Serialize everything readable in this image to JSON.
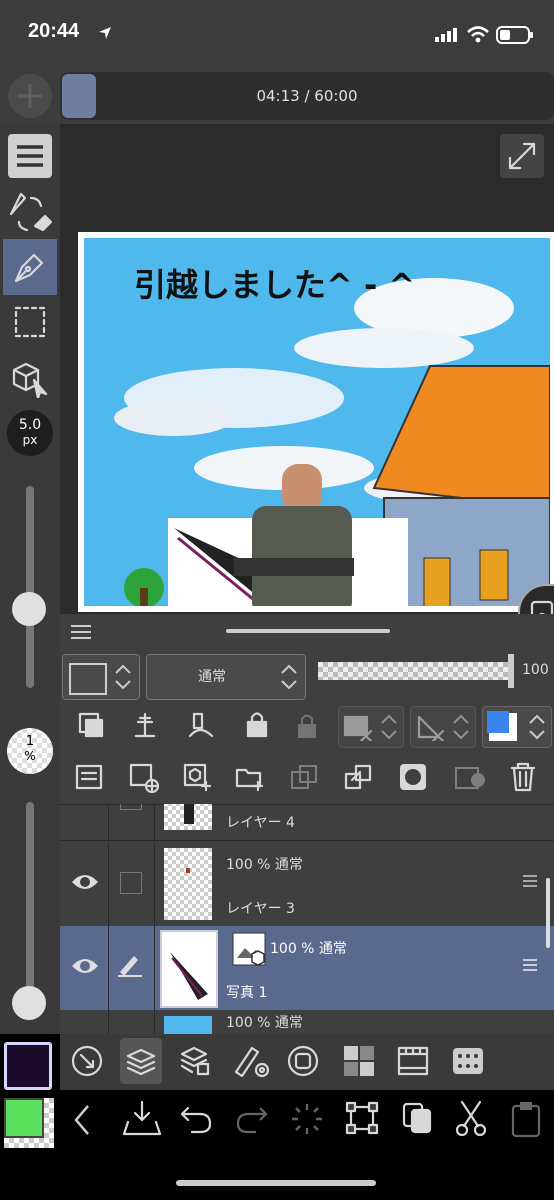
{
  "status_bar": {
    "time": "20:44"
  },
  "top_bar": {
    "timer": "04:13 / 60:00"
  },
  "left_toolbar": {
    "brush_size_value": "5.0",
    "brush_size_unit": "px",
    "opacity_value": "1",
    "opacity_unit": "%"
  },
  "artwork": {
    "caption": "引越しました^ - ^"
  },
  "layer_panel": {
    "blend_mode": "通常",
    "opacity_value": "100",
    "layers": [
      {
        "name": "レイヤー 4",
        "info": ""
      },
      {
        "name": "レイヤー 3",
        "info": "100 % 通常"
      },
      {
        "name": "写真 1",
        "info": "100 % 通常"
      },
      {
        "name": "",
        "info": "100 % 通常"
      }
    ]
  },
  "colors": {
    "main": "#1a0c2a",
    "sub": "#5de05d",
    "accent": "#3a86f0"
  }
}
